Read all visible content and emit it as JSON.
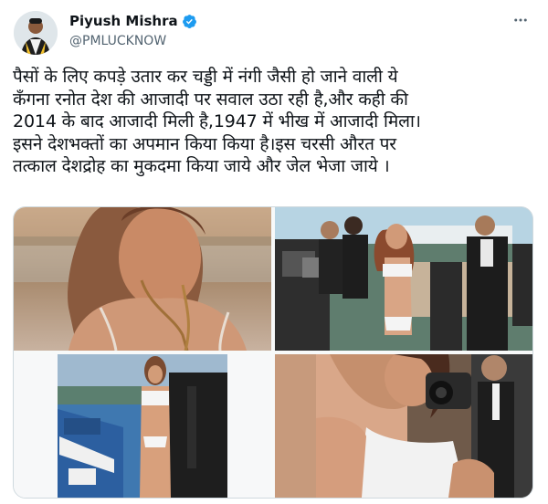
{
  "author": {
    "name": "Piyush Mishra",
    "handle": "@PMLUCKNOW",
    "verified": true,
    "avatar_icon": "profile-photo",
    "verified_icon": "verified-badge-icon"
  },
  "tweet": {
    "lines": [
      "पैसों के लिए कपड़े उतार कर चड्डी में नंगी जैसी हो जाने वाली ये",
      "कँगना रनोत देश की आजादी पर सवाल उठा रही है,और कही की",
      "2014 के बाद आजादी मिली है,1947 में भीख में आजादी मिला।",
      "इसने देशभक्तों का अपमान किया किया है।इस चरसी औरत पर",
      "तत्काल देशद्रोह का मुकदमा किया जाये और जेल भेजा जाये ।"
    ]
  },
  "media": {
    "count": 4,
    "images": [
      "photo-1",
      "photo-2",
      "photo-3",
      "photo-4"
    ]
  },
  "colors": {
    "text": "#0f1419",
    "secondary": "#536471",
    "verified": "#1d9bf0",
    "border": "#cfd9de"
  }
}
